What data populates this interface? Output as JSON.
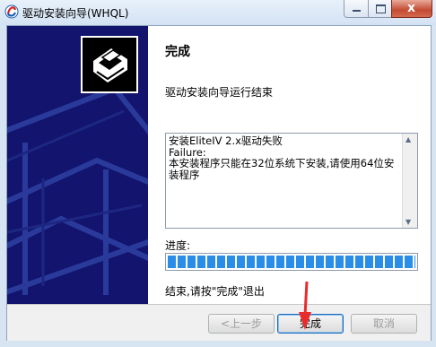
{
  "window": {
    "title": "驱动安装向导(WHQL)",
    "close_label": "x"
  },
  "wizard": {
    "heading": "完成",
    "subtitle": "驱动安装向导运行结束",
    "log_text": "安装EliteIV 2.x驱动失败\nFailure:\n本安装程序只能在32位系统下安装,请使用64位安装程序",
    "progress_label": "进度:",
    "progress_value": 1.0,
    "finish_note": "结束,请按\"完成\"退出"
  },
  "buttons": {
    "back": "<上一步",
    "finish": "完成",
    "cancel": "取消"
  },
  "colors": {
    "banner": "#12146e",
    "progress": "#2a8ee8",
    "annotation_arrow": "#e82c2c"
  }
}
